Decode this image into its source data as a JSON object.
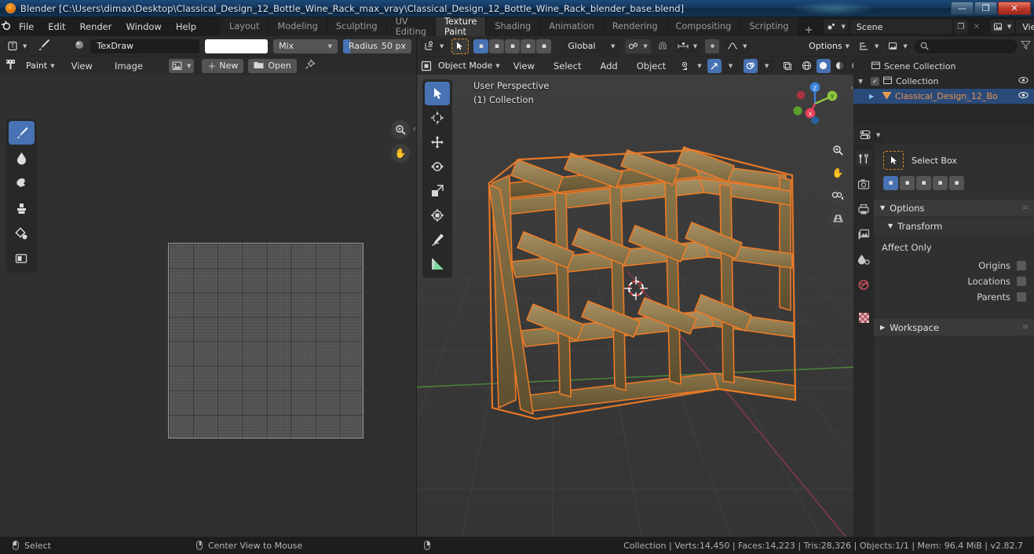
{
  "window": {
    "title": "Blender [C:\\Users\\dimax\\Desktop\\Classical_Design_12_Bottle_Wine_Rack_max_vray\\Classical_Design_12_Bottle_Wine_Rack_blender_base.blend]",
    "minimize": "—",
    "maximize": "❐",
    "close": "✕"
  },
  "topbar": {
    "logo_icon": "blender-logo",
    "menus": [
      "File",
      "Edit",
      "Render",
      "Window",
      "Help"
    ],
    "workspaces": [
      {
        "label": "Layout",
        "active": false
      },
      {
        "label": "Modeling",
        "active": false
      },
      {
        "label": "Sculpting",
        "active": false
      },
      {
        "label": "UV Editing",
        "active": false
      },
      {
        "label": "Texture Paint",
        "active": true
      },
      {
        "label": "Shading",
        "active": false
      },
      {
        "label": "Animation",
        "active": false
      },
      {
        "label": "Rendering",
        "active": false
      },
      {
        "label": "Compositing",
        "active": false
      },
      {
        "label": "Scripting",
        "active": false
      }
    ],
    "add_workspace": "+",
    "scene": {
      "icon": "scene-icon",
      "name": "Scene",
      "new_icon": "duplicate-icon",
      "unlink_icon": "✕"
    },
    "view_layer": {
      "icon": "view-layer-icon",
      "name": "View Layer",
      "new_icon": "duplicate-icon",
      "unlink_icon": "✕"
    }
  },
  "texture_paint": {
    "header": {
      "editor_type": "image-editor-icon",
      "mode_icon": "brush-icon",
      "brush_preview": "brush-sphere-icon",
      "brush_name": "TexDraw",
      "color": "#ffffff",
      "blend_mode": "Mix",
      "radius_label": "Radius",
      "radius_value": "50 px"
    },
    "header2": {
      "paint_mode_icon": "texture-paint-icon",
      "mode": "Paint",
      "menus": [
        "View",
        "Image"
      ],
      "image_icon": "image-icon",
      "new_button": "New",
      "open_button": "Open",
      "pin_icon": "pin-icon"
    },
    "tools": [
      {
        "name": "draw-tool",
        "icon": "✎",
        "active": true
      },
      {
        "name": "soften-tool",
        "icon": "💧",
        "active": false
      },
      {
        "name": "smear-tool",
        "icon": "☛",
        "active": false
      },
      {
        "name": "clone-tool",
        "icon": "⬛",
        "active": false
      },
      {
        "name": "fill-tool",
        "icon": "◈",
        "active": false
      },
      {
        "name": "mask-tool",
        "icon": "▣",
        "active": false
      }
    ],
    "zoom_icon": "zoom-icon",
    "pan_icon": "hand-icon",
    "collapse_icon": "‹"
  },
  "viewport": {
    "header": {
      "transform_orientation_icon": "snap-icon",
      "cursor_icon": "select-box-icon",
      "select_modes": [
        "set",
        "extend",
        "subtract",
        "invert",
        "intersect"
      ],
      "orientation": "Global",
      "pivot_icon": "pivot-icon",
      "snap_magnet_icon": "magnet-icon",
      "snap_to_icon": "snap-increment-icon",
      "proportional_icon": "proportional-editing-icon",
      "falloff_icon": "falloff-curve-icon",
      "options": "Options"
    },
    "header2": {
      "mode_icon": "object-mode-icon",
      "mode": "Object Mode",
      "menus": [
        "View",
        "Select",
        "Add",
        "Object"
      ],
      "visibility_icon": "visibility-icon",
      "gizmo_icon": "gizmo-icon",
      "overlays_icon": "overlays-icon",
      "xray_icon": "xray-icon",
      "shading_modes": [
        "wireframe",
        "solid",
        "material-preview",
        "rendered"
      ],
      "shading_active_index": 1
    },
    "overlay_text": [
      "User Perspective",
      "(1) Collection"
    ],
    "tools": [
      {
        "name": "select-box-tool",
        "icon": "▶",
        "active": true
      },
      {
        "name": "cursor-tool",
        "icon": "✛",
        "active": false
      },
      {
        "name": "move-tool",
        "icon": "✥",
        "active": false
      },
      {
        "name": "rotate-tool",
        "icon": "⟳",
        "active": false
      },
      {
        "name": "scale-tool",
        "icon": "⧉",
        "active": false
      },
      {
        "name": "transform-tool",
        "icon": "✧",
        "active": false
      },
      {
        "name": "annotate-tool",
        "icon": "✏",
        "active": false
      },
      {
        "name": "measure-tool",
        "icon": "📐",
        "active": false
      }
    ],
    "nav_buttons": [
      {
        "name": "zoom-button",
        "icon": "⊕"
      },
      {
        "name": "pan-button",
        "icon": "✋"
      },
      {
        "name": "camera-view-button",
        "icon": "🎥"
      },
      {
        "name": "toggle-perspective-button",
        "icon": "▦"
      }
    ],
    "gizmo_axes": [
      {
        "label": "Z",
        "color": "#2e8fe0"
      },
      {
        "label": "Y",
        "color": "#8ec63f"
      },
      {
        "label": "X",
        "color": "#e8405a"
      }
    ],
    "collapse_icon": "›",
    "model_color": "#9c8355",
    "selection_outline_color": "#ed7b26"
  },
  "outliner": {
    "display_mode_icon": "outliner-icon",
    "filter_type_icon": "view-layer-icon",
    "search_icon": "search-icon",
    "search_placeholder": "",
    "filter_icon": "filter-icon",
    "rows": [
      {
        "name": "Scene Collection",
        "icon": "collection-icon",
        "indent": 0,
        "selected": false,
        "expander": "",
        "checkbox": false,
        "eye": false
      },
      {
        "name": "Collection",
        "icon": "collection-icon",
        "indent": 1,
        "selected": false,
        "expander": "▼",
        "checkbox": true,
        "eye": true
      },
      {
        "name": "Classical_Design_12_Bo",
        "icon": "mesh-object-icon",
        "indent": 2,
        "selected": true,
        "expander": "▶",
        "checkbox": false,
        "eye": true
      }
    ]
  },
  "properties": {
    "editor_icon": "properties-editor-icon",
    "tabs": [
      {
        "name": "tool-tab",
        "icon": "🛠",
        "active": true
      },
      {
        "name": "render-tab",
        "icon": "📷",
        "active": false
      },
      {
        "name": "output-tab",
        "icon": "🖨",
        "active": false
      },
      {
        "name": "view-layer-tab",
        "icon": "🖼",
        "active": false
      },
      {
        "name": "scene-tab",
        "icon": "💧",
        "active": false
      },
      {
        "name": "world-tab",
        "icon": "🌐",
        "active": false
      },
      {
        "name": "texture-tab",
        "icon": "▩",
        "active": false
      }
    ],
    "active_tool": {
      "icon": "select-box-icon",
      "label": "Select Box",
      "modes": [
        "set",
        "extend",
        "subtract",
        "invert",
        "intersect"
      ],
      "active_mode_index": 0
    },
    "sections": [
      {
        "label": "Options",
        "expanded": true,
        "arrow": "▼"
      },
      {
        "label": "Transform",
        "expanded": true,
        "arrow": "▼",
        "sub": true
      }
    ],
    "affect_only": {
      "label": "Affect Only",
      "rows": [
        {
          "label": "Origins",
          "checked": false
        },
        {
          "label": "Locations",
          "checked": false
        },
        {
          "label": "Parents",
          "checked": false
        }
      ]
    },
    "workspace_section": {
      "label": "Workspace",
      "arrow": "▶"
    }
  },
  "statusbar": {
    "left": [
      {
        "icon": "mouse-left-icon",
        "label": "Select"
      },
      {
        "icon": "mouse-middle-icon",
        "label": "Center View to Mouse"
      },
      {
        "icon": "mouse-right-icon",
        "label": ""
      }
    ],
    "stats": "Collection | Verts:14,450 | Faces:14,223 | Tris:28,326 | Objects:1/1 | Mem: 96.4 MiB | v2.82.7"
  }
}
